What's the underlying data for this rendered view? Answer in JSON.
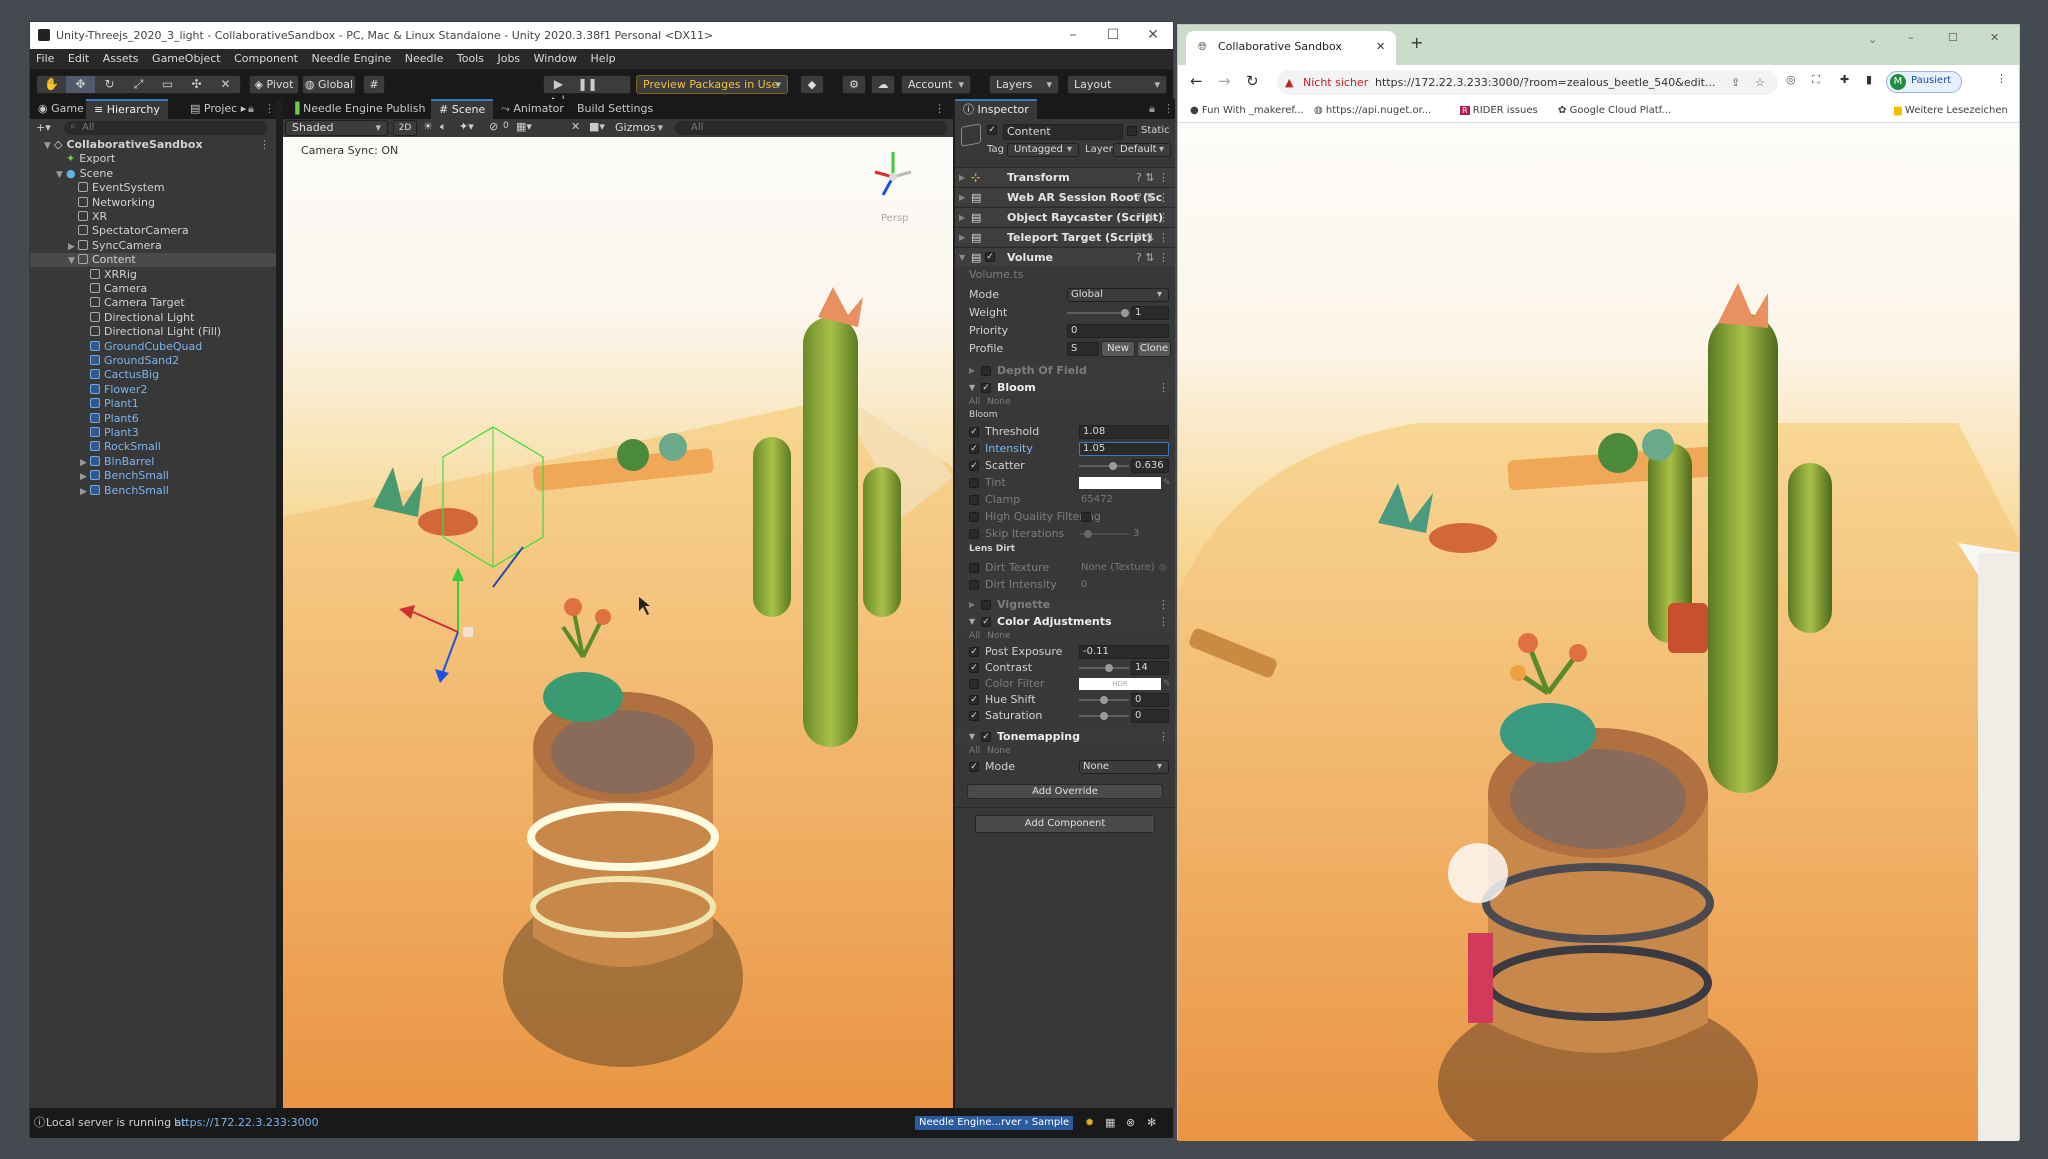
{
  "unity": {
    "title": "Unity-Threejs_2020_3_light - CollaborativeSandbox - PC, Mac & Linux Standalone - Unity 2020.3.38f1 Personal <DX11>",
    "menu": [
      "File",
      "Edit",
      "Assets",
      "GameObject",
      "Component",
      "Needle Engine",
      "Needle",
      "Tools",
      "Jobs",
      "Window",
      "Help"
    ],
    "toolbar": {
      "pivot": "Pivot",
      "global": "Global",
      "preview_packages": "Preview Packages in Use",
      "account": "Account",
      "layers": "Layers",
      "layout": "Layout"
    },
    "left_tabs": {
      "game": "Game",
      "hierarchy": "Hierarchy",
      "project": "Projec"
    },
    "hierarchy_search": "All",
    "hierarchy": [
      {
        "label": "CollaborativeSandbox",
        "depth": 0,
        "kind": "scene",
        "fold": "▼",
        "style": "root"
      },
      {
        "label": "Export",
        "depth": 1,
        "kind": "gear",
        "fold": "",
        "style": ""
      },
      {
        "label": "Scene",
        "depth": 1,
        "kind": "dot",
        "fold": "▼",
        "style": ""
      },
      {
        "label": "EventSystem",
        "depth": 2,
        "kind": "cube",
        "fold": "",
        "style": ""
      },
      {
        "label": "Networking",
        "depth": 2,
        "kind": "cube",
        "fold": "",
        "style": ""
      },
      {
        "label": "XR",
        "depth": 2,
        "kind": "cube",
        "fold": "",
        "style": ""
      },
      {
        "label": "SpectatorCamera",
        "depth": 2,
        "kind": "cube",
        "fold": "",
        "style": ""
      },
      {
        "label": "SyncCamera",
        "depth": 2,
        "kind": "cube",
        "fold": "▶",
        "style": ""
      },
      {
        "label": "Content",
        "depth": 2,
        "kind": "cube",
        "fold": "▼",
        "style": "sel"
      },
      {
        "label": "XRRig",
        "depth": 3,
        "kind": "cube",
        "fold": "",
        "style": ""
      },
      {
        "label": "Camera",
        "depth": 3,
        "kind": "cube",
        "fold": "",
        "style": ""
      },
      {
        "label": "Camera Target",
        "depth": 3,
        "kind": "cube",
        "fold": "",
        "style": ""
      },
      {
        "label": "Directional Light",
        "depth": 3,
        "kind": "cube",
        "fold": "",
        "style": ""
      },
      {
        "label": "Directional Light (Fill)",
        "depth": 3,
        "kind": "cube",
        "fold": "",
        "style": ""
      },
      {
        "label": "GroundCubeQuad",
        "depth": 3,
        "kind": "bcube",
        "fold": "",
        "style": "blue"
      },
      {
        "label": "GroundSand2",
        "depth": 3,
        "kind": "bcube",
        "fold": "",
        "style": "blue"
      },
      {
        "label": "CactusBig",
        "depth": 3,
        "kind": "bcube",
        "fold": "",
        "style": "blue"
      },
      {
        "label": "Flower2",
        "depth": 3,
        "kind": "bcube",
        "fold": "",
        "style": "blue"
      },
      {
        "label": "Plant1",
        "depth": 3,
        "kind": "bcube",
        "fold": "",
        "style": "blue"
      },
      {
        "label": "Plant6",
        "depth": 3,
        "kind": "bcube",
        "fold": "",
        "style": "blue"
      },
      {
        "label": "Plant3",
        "depth": 3,
        "kind": "bcube",
        "fold": "",
        "style": "blue"
      },
      {
        "label": "RockSmall",
        "depth": 3,
        "kind": "bcube",
        "fold": "",
        "style": "blue"
      },
      {
        "label": "BlnBarrel",
        "depth": 3,
        "kind": "bcube",
        "fold": "▶",
        "style": "blue"
      },
      {
        "label": "BenchSmall",
        "depth": 3,
        "kind": "bcube",
        "fold": "▶",
        "style": "blue"
      },
      {
        "label": "BenchSmall",
        "depth": 3,
        "kind": "bcube",
        "fold": "▶",
        "style": "blue"
      }
    ],
    "scene_tabs": {
      "needle": "Needle Engine Publish",
      "scene": "Scene",
      "animator": "Animator",
      "build": "Build Settings"
    },
    "scene_toolbar": {
      "shading": "Shaded",
      "mode2d": "2D",
      "gizmos": "Gizmos",
      "search": "All",
      "layers_count": "0"
    },
    "scene_overlay": "Camera Sync: ON",
    "gizmo_label": "Persp",
    "inspector": {
      "tab": "Inspector",
      "object_name": "Content",
      "static_label": "Static",
      "tag_label": "Tag",
      "tag_value": "Untagged",
      "layer_label": "Layer",
      "layer_value": "Default",
      "components": [
        "Transform",
        "Web AR Session Root (Sc",
        "Object Raycaster (Script)",
        "Teleport Target (Script)",
        "Volume"
      ],
      "volume_file": "Volume.ts",
      "mode_label": "Mode",
      "mode_value": "Global",
      "weight_label": "Weight",
      "weight_value": "1",
      "priority_label": "Priority",
      "priority_value": "0",
      "profile_label": "Profile",
      "profile_value": "S",
      "new_btn": "New",
      "clone_btn": "Clone",
      "dof": "Depth Of Field",
      "bloom": {
        "title": "Bloom",
        "all": "All",
        "none": "None",
        "section": "Bloom",
        "threshold_label": "Threshold",
        "threshold": "1.08",
        "intensity_label": "Intensity",
        "intensity": "1.05",
        "scatter_label": "Scatter",
        "scatter": "0.636",
        "tint_label": "Tint",
        "clamp_label": "Clamp",
        "clamp": "65472",
        "hq_label": "High Quality Filtering",
        "skip_label": "Skip Iterations",
        "skip": "3",
        "lens_dirt": "Lens Dirt",
        "dirt_tex_label": "Dirt Texture",
        "dirt_tex": "None (Texture)",
        "dirt_int_label": "Dirt Intensity",
        "dirt_int": "0"
      },
      "vignette": "Vignette",
      "color_adj": {
        "title": "Color Adjustments",
        "all": "All",
        "none": "None",
        "post_exposure_label": "Post Exposure",
        "post_exposure": "-0.11",
        "contrast_label": "Contrast",
        "contrast": "14",
        "color_filter_label": "Color Filter",
        "hdr": "HDR",
        "hue_label": "Hue Shift",
        "hue": "0",
        "sat_label": "Saturation",
        "sat": "0"
      },
      "tonemapping": {
        "title": "Tonemapping",
        "all": "All",
        "none": "None",
        "mode_label": "Mode",
        "mode": "None"
      },
      "add_override": "Add Override",
      "add_component": "Add Component"
    },
    "status": {
      "prefix": "Local server is running at",
      "url": "https://172.22.3.233:3000",
      "badge": "Needle Engine...rver › Sample"
    }
  },
  "chrome": {
    "tab_title": "Collaborative Sandbox",
    "security": "Nicht sicher",
    "url": "https://172.22.3.233:3000/?room=zealous_beetle_540&edit...",
    "profile": "Pausiert",
    "avatar": "M",
    "bookmarks": [
      "Fun With _makeref...",
      "https://api.nuget.or...",
      "RIDER issues",
      "Google Cloud Platf..."
    ],
    "other_bookmarks": "Weitere Lesezeichen"
  },
  "colors": {
    "accent": "#3a79bb",
    "unity_bg": "#383838",
    "chrome_frame": "#ccdccb",
    "sand": "#f2b660"
  }
}
